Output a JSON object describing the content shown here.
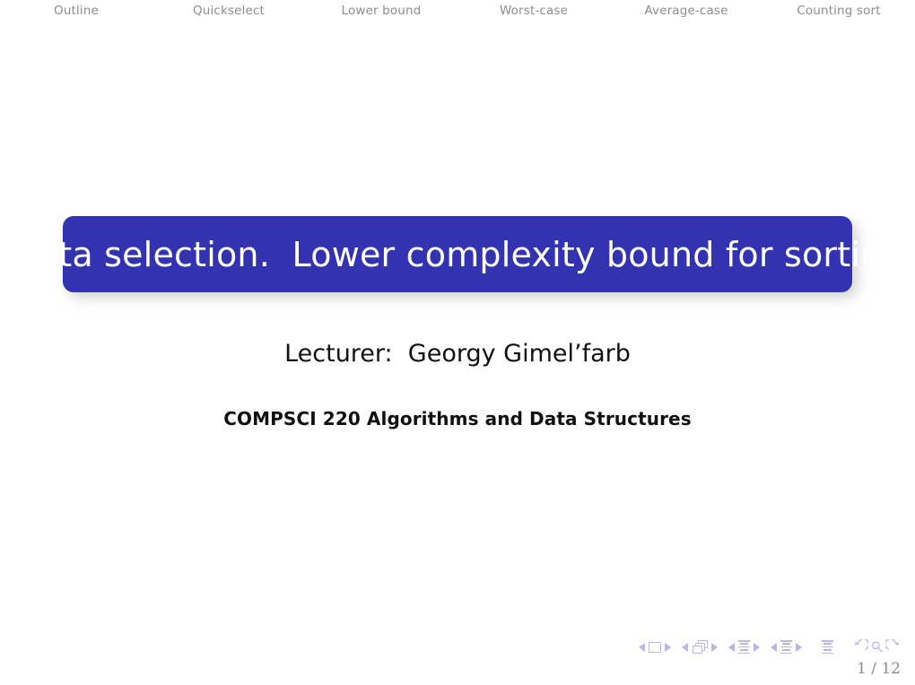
{
  "slide": {
    "background_color": "#ffffff",
    "kind": "beamer-title-slide"
  },
  "navbar": {
    "items": [
      {
        "label": "Outline"
      },
      {
        "label": "Quickselect"
      },
      {
        "label": "Lower bound"
      },
      {
        "label": "Worst-case"
      },
      {
        "label": "Average-case"
      },
      {
        "label": "Counting sort"
      }
    ],
    "text_color": "#8d8d8d"
  },
  "title_block": {
    "title": "Data selection.  Lower complexity bound for sorting",
    "background_color": "#3333b2",
    "text_color": "#ffffff"
  },
  "author": {
    "line": "Lecturer:  Georgy Gimel’farb"
  },
  "institute": {
    "line": "COMPSCI 220 Algorithms and Data Structures"
  },
  "nav_symbols": {
    "color": "#b7b7e2",
    "groups": [
      {
        "icon": "slide-icon",
        "prev": "◂",
        "next": "▸"
      },
      {
        "icon": "frame-icon",
        "prev": "◂",
        "next": "▸"
      },
      {
        "icon": "subsection-icon",
        "prev": "◂",
        "next": "▸"
      },
      {
        "icon": "section-icon",
        "prev": "◂",
        "next": "▸"
      }
    ],
    "document_icon": "document-icon",
    "back_icon": "go-back-icon",
    "search_icon": "search-icon",
    "forward_icon": "go-forward-icon"
  },
  "footer": {
    "page_number": "1 / 12",
    "text_color": "#8d8d8d"
  }
}
